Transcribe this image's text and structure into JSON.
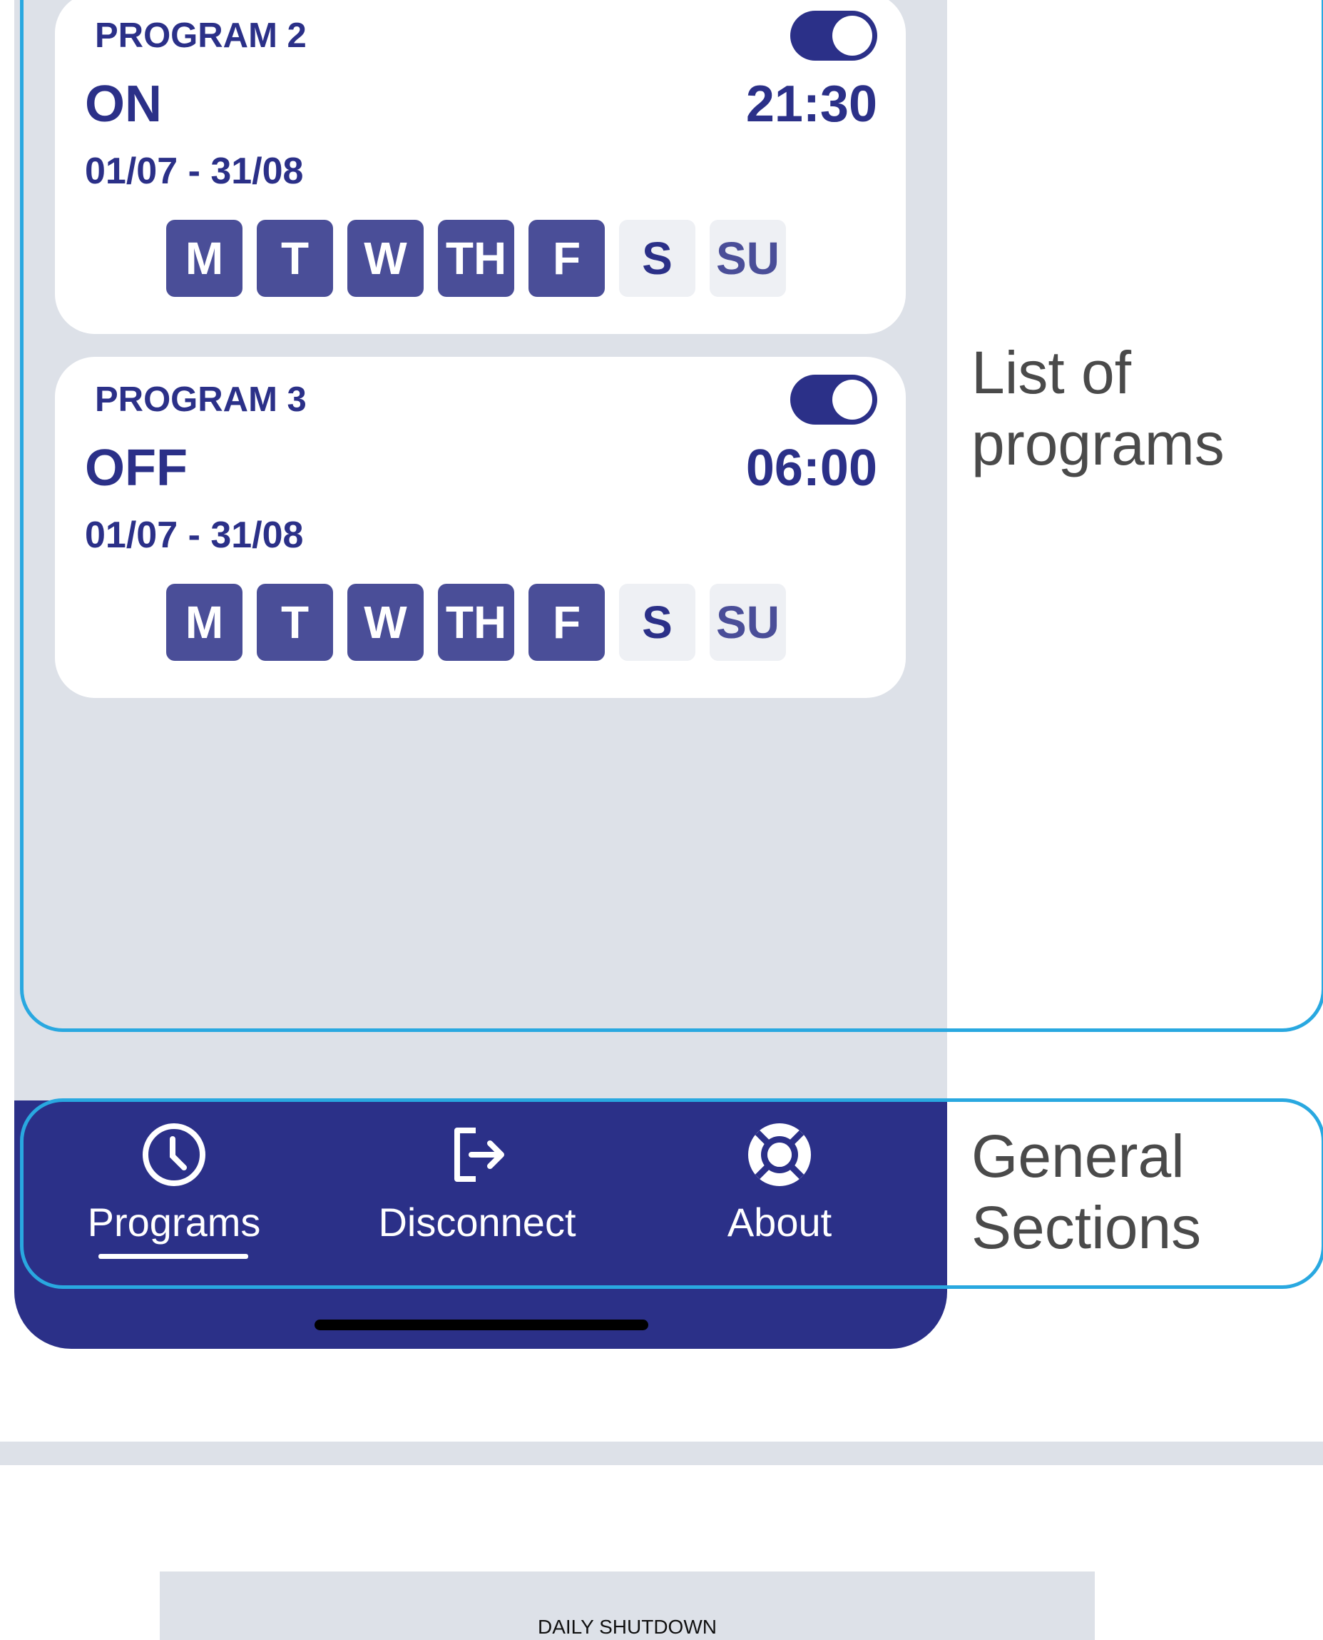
{
  "programs": [
    {
      "name": "PROGRAM 2",
      "state": "ON",
      "time": "21:30",
      "range": "01/07 - 31/08",
      "enabled": true,
      "days": [
        {
          "label": "M",
          "active": true
        },
        {
          "label": "T",
          "active": true
        },
        {
          "label": "W",
          "active": true
        },
        {
          "label": "TH",
          "active": true
        },
        {
          "label": "F",
          "active": true
        },
        {
          "label": "S",
          "active": false
        },
        {
          "label": "SU",
          "active": false
        }
      ]
    },
    {
      "name": "PROGRAM 3",
      "state": "OFF",
      "time": "06:00",
      "range": "01/07 - 31/08",
      "enabled": true,
      "days": [
        {
          "label": "M",
          "active": true
        },
        {
          "label": "T",
          "active": true
        },
        {
          "label": "W",
          "active": true
        },
        {
          "label": "TH",
          "active": true
        },
        {
          "label": "F",
          "active": true
        },
        {
          "label": "S",
          "active": false
        },
        {
          "label": "SU",
          "active": false
        }
      ]
    }
  ],
  "nav": {
    "items": [
      {
        "label": "Programs",
        "icon": "clock-icon",
        "active": true
      },
      {
        "label": "Disconnect",
        "icon": "logout-icon",
        "active": false
      },
      {
        "label": "About",
        "icon": "lifebuoy-icon",
        "active": false
      }
    ]
  },
  "annotations": {
    "programs_line1": "List of",
    "programs_line2": "programs",
    "sections_line1": "General",
    "sections_line2": "Sections"
  },
  "bottom_panel": {
    "title": "DAILY SHUTDOWN"
  },
  "colors": {
    "primary": "#2b3088",
    "day_active": "#4a4e98",
    "background": "#dde1e8",
    "annotation_outline": "#29a8e0"
  }
}
